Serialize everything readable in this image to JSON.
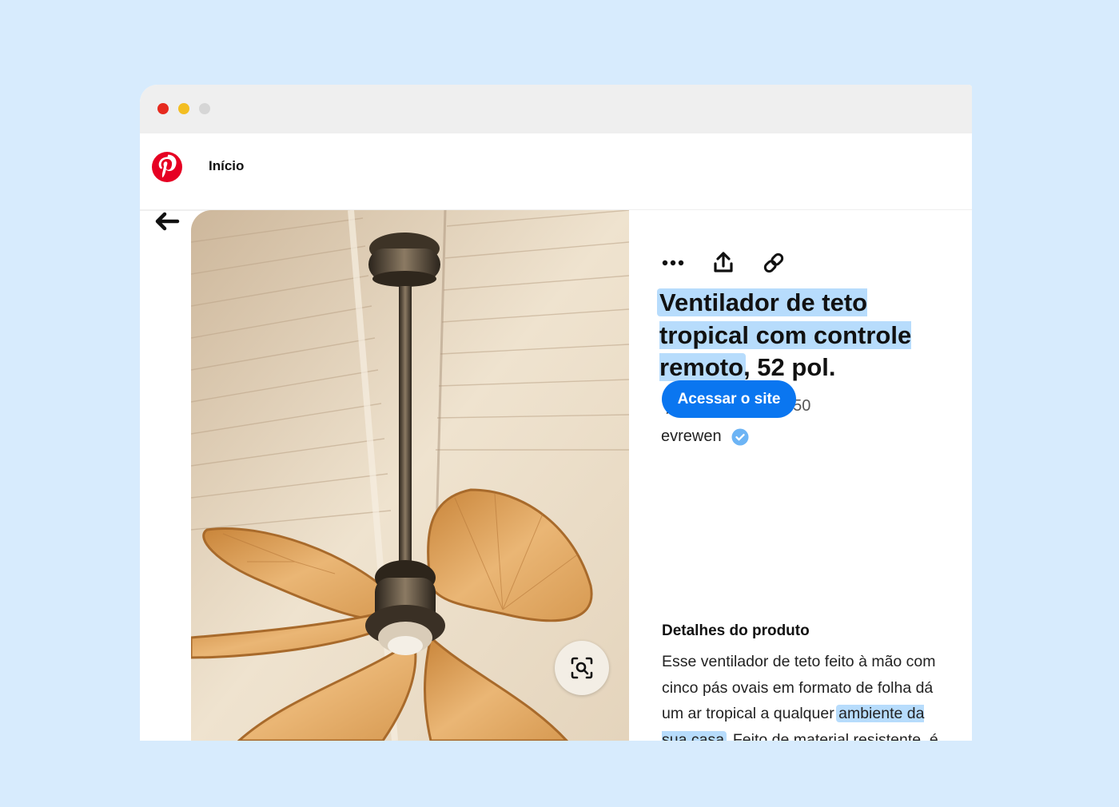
{
  "nav": {
    "home_label": "Início"
  },
  "pin": {
    "title_highlighted": "Ventilador de teto tropical com controle remoto",
    "title_rest": ", 52 pol.",
    "rating_count": "150",
    "creator": "evrewen",
    "cta_label": "Acessar o site",
    "details_heading": "Detalhes do produto",
    "description_before": "Esse ventilador de teto feito à mão com cinco pás ovais em formato de folha dá um ar tropical a qualquer ",
    "description_highlighted": "ambiente da sua casa",
    "description_after": ". Feito de material resistente, é fácil de limpar com um pano seco."
  },
  "icons": [
    "pinterest-logo-icon",
    "back-arrow-icon",
    "more-options-icon",
    "share-icon",
    "copy-link-icon",
    "star-icon",
    "verified-icon",
    "visual-search-icon"
  ],
  "colors": {
    "background": "#d7ebfd",
    "brand_red": "#e60023",
    "cta_blue": "#0a76f0",
    "highlight": "#b7dcfc",
    "verified": "#6cb4f5"
  }
}
